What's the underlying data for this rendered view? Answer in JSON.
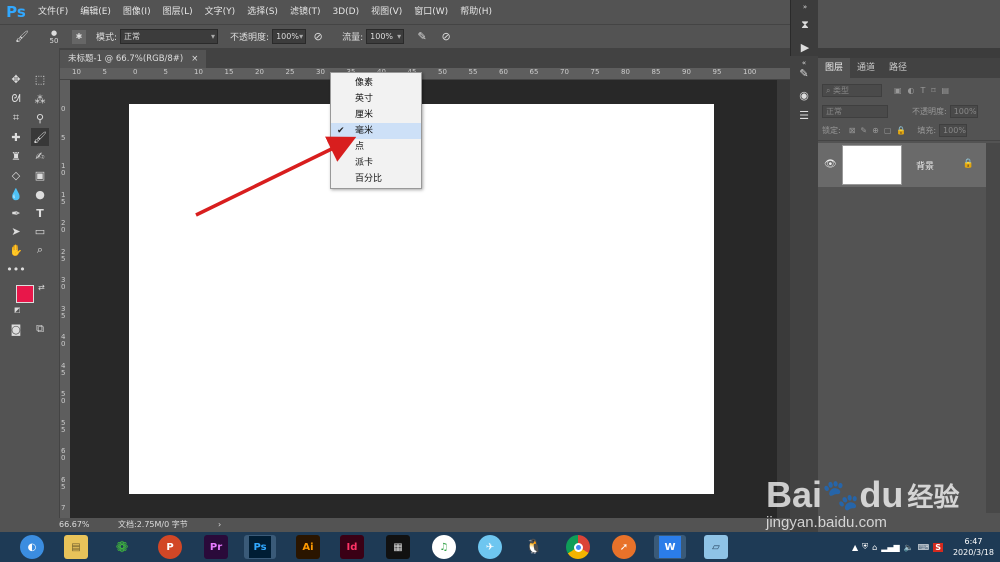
{
  "app": {
    "logo": "Ps"
  },
  "menubar": {
    "items": [
      "文件(F)",
      "编辑(E)",
      "图像(I)",
      "图层(L)",
      "文字(Y)",
      "选择(S)",
      "滤镜(T)",
      "3D(D)",
      "视图(V)",
      "窗口(W)",
      "帮助(H)"
    ]
  },
  "options": {
    "brush_size": "50",
    "mode_label": "模式:",
    "mode_value": "正常",
    "opacity_label": "不透明度:",
    "opacity_value": "100%",
    "flow_label": "流量:",
    "flow_value": "100%"
  },
  "document": {
    "tab_title": "未标题-1 @ 66.7%(RGB/8#)",
    "close": "×"
  },
  "ruler": {
    "h_ticks": [
      "10",
      "5",
      "0",
      "5",
      "10",
      "15",
      "20",
      "25",
      "30",
      "35",
      "40",
      "45",
      "50",
      "55",
      "60",
      "65",
      "70",
      "75",
      "80",
      "85",
      "90",
      "95",
      "100"
    ],
    "v_ticks": [
      "0",
      "5",
      "1\n0",
      "1\n5",
      "2\n0",
      "2\n5",
      "3\n0",
      "3\n5",
      "4\n0",
      "4\n5",
      "5\n0",
      "5\n5",
      "6\n0",
      "6\n5",
      "7"
    ]
  },
  "status": {
    "zoom": "66.67%",
    "doc_info": "文档:2.75M/0 字节"
  },
  "context_menu": {
    "items": [
      "像素",
      "英寸",
      "厘米",
      "毫米",
      "点",
      "派卡",
      "百分比"
    ],
    "checked_index": 3
  },
  "layers_panel": {
    "tabs": [
      "图层",
      "通道",
      "路径"
    ],
    "filter_label": "类型",
    "blend_mode": "正常",
    "opacity_label": "不透明度:",
    "opacity_value": "100%",
    "lock_label": "锁定:",
    "fill_label": "填充:",
    "fill_value": "100%",
    "layer_name": "背景"
  },
  "colors": {
    "foreground": "#e8174a",
    "background": "#000000",
    "arrow": "#d81e1e",
    "ps_blue": "#31a8ff"
  },
  "taskbar": {
    "apps": [
      "browser-icon",
      "explorer-icon",
      "wechat-icon",
      "powerpoint-icon",
      "premiere-icon",
      "photoshop-icon",
      "illustrator-icon",
      "indesign-icon",
      "video-icon",
      "qq-music-icon",
      "bird-icon",
      "qq-icon",
      "chrome-icon",
      "fox-icon",
      "wps-icon",
      "notes-icon"
    ],
    "app_labels": {
      "premiere": "Pr",
      "photoshop": "Ps",
      "illustrator": "Ai",
      "indesign": "Id"
    },
    "clock_time": "6:47",
    "clock_date": "2020/3/18",
    "ime": "S"
  },
  "watermark": {
    "brand": "Bai",
    "brand2": "du",
    "chinese": "经验",
    "url": "jingyan.baidu.com"
  }
}
